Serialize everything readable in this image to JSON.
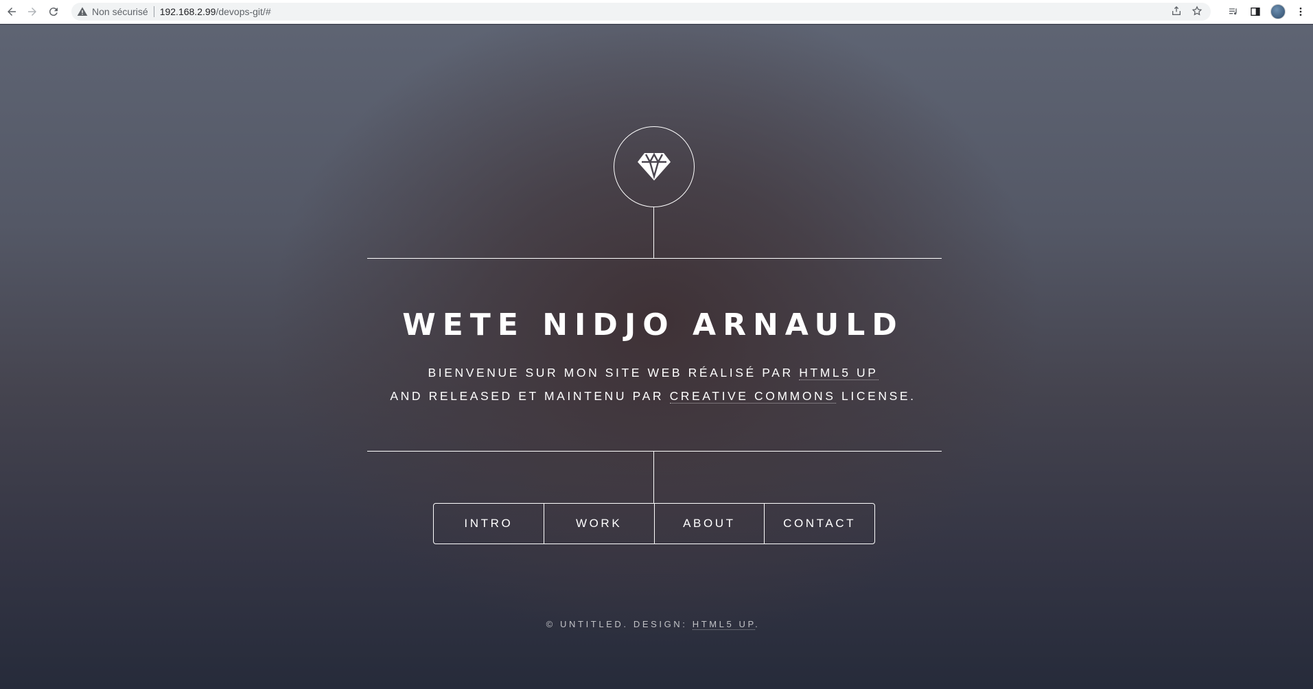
{
  "browser": {
    "security_label": "Non sécurisé",
    "url_host": "192.168.2.99",
    "url_path": "/devops-git/#"
  },
  "header": {
    "title": "WETE NIDJO ARNAULD",
    "intro_part1": "Bienvenue sur mon site web réalisé par ",
    "intro_link1": "html5 up",
    "intro_part2": " and released et maintenu par ",
    "intro_link2": "Creative Commons",
    "intro_part3": " license."
  },
  "nav": {
    "items": [
      {
        "label": "INTRO"
      },
      {
        "label": "WORK"
      },
      {
        "label": "ABOUT"
      },
      {
        "label": "CONTACT"
      }
    ]
  },
  "footer": {
    "text": "© UNTITLED. DESIGN: ",
    "link": "HTML5 UP",
    "suffix": "."
  },
  "icons": {
    "logo": "diamond-icon",
    "back": "arrow-left-icon",
    "forward": "arrow-right-icon",
    "reload": "reload-icon",
    "warning": "warning-triangle-icon",
    "share": "share-icon",
    "star": "star-icon",
    "media": "media-queue-icon",
    "sidepanel": "side-panel-icon",
    "menu": "kebab-menu-icon"
  }
}
